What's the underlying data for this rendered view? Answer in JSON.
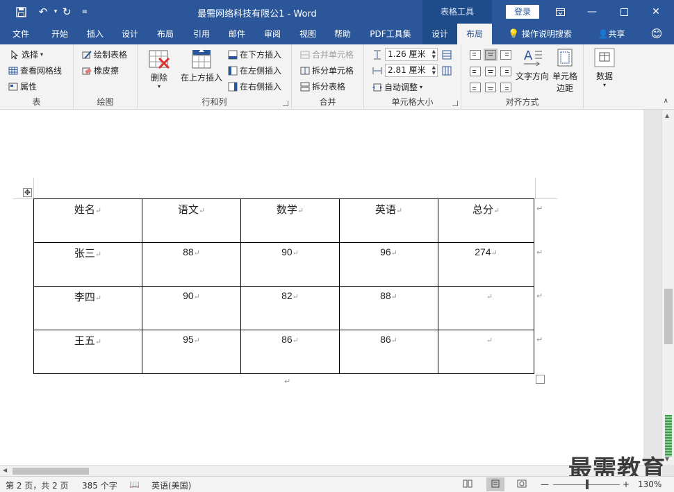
{
  "title_bar": {
    "doc_title": "最需网络科技有限公1  -  Word",
    "context_group": "表格工具",
    "login": "登录"
  },
  "tabs": [
    {
      "label": "文件"
    },
    {
      "label": "开始"
    },
    {
      "label": "插入"
    },
    {
      "label": "设计"
    },
    {
      "label": "布局"
    },
    {
      "label": "引用"
    },
    {
      "label": "邮件"
    },
    {
      "label": "审阅"
    },
    {
      "label": "视图"
    },
    {
      "label": "帮助"
    },
    {
      "label": "PDF工具集"
    },
    {
      "label": "设计"
    },
    {
      "label": "布局"
    }
  ],
  "tell_me": "操作说明搜索",
  "share": "共享",
  "ribbon": {
    "table_group": {
      "label": "表",
      "select": "选择",
      "gridlines": "查看网格线",
      "properties": "属性"
    },
    "draw_group": {
      "label": "绘图",
      "draw_table": "绘制表格",
      "eraser": "橡皮擦"
    },
    "rows_cols_group": {
      "label": "行和列",
      "delete": "删除",
      "insert_above": "在上方插入",
      "insert_below": "在下方插入",
      "insert_left": "在左侧插入",
      "insert_right": "在右侧插入"
    },
    "merge_group": {
      "label": "合并",
      "merge_cells": "合并单元格",
      "split_cells": "拆分单元格",
      "split_table": "拆分表格"
    },
    "cell_size_group": {
      "label": "单元格大小",
      "height": "1.26 厘米",
      "width": "2.81 厘米",
      "autofit": "自动调整"
    },
    "alignment_group": {
      "label": "对齐方式",
      "text_direction": "文字方向",
      "cell_margins_1": "单元格",
      "cell_margins_2": "边距"
    },
    "data_group": {
      "label": "数据"
    }
  },
  "table": {
    "headers": [
      "姓名",
      "语文",
      "数学",
      "英语",
      "总分"
    ],
    "rows": [
      [
        "张三",
        "88",
        "90",
        "96",
        "274"
      ],
      [
        "李四",
        "90",
        "82",
        "88",
        ""
      ],
      [
        "王五",
        "95",
        "86",
        "86",
        ""
      ]
    ]
  },
  "status": {
    "page": "第 2 页，共 2 页",
    "words": "385 个字",
    "language": "英语(美国)",
    "zoom": "130%"
  },
  "watermark": "最需教育"
}
